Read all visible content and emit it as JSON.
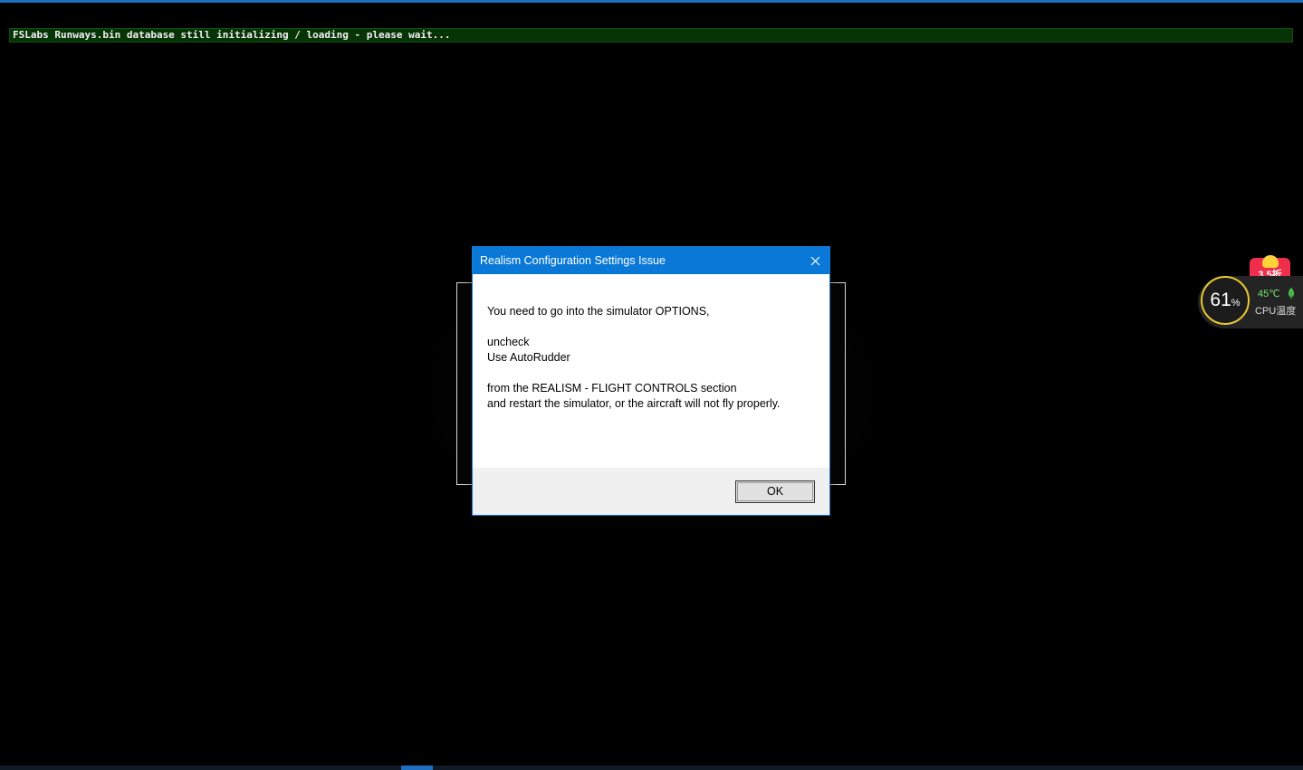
{
  "banner": {
    "text": "FSLabs Runways.bin database still initializing / loading - please wait..."
  },
  "dialog": {
    "title": "Realism Configuration Settings Issue",
    "lines": [
      "You need to go into the simulator OPTIONS,",
      "uncheck",
      "Use AutoRudder",
      "from the REALISM - FLIGHT CONTROLS section",
      "and restart the simulator, or the aircraft will not fly properly."
    ],
    "ok_label": "OK"
  },
  "cpu_widget": {
    "usage": "61",
    "usage_unit": "%",
    "temperature": "45℃",
    "label": "CPU温度",
    "promo": "3.5折"
  },
  "colors": {
    "accent": "#0a78d7",
    "banner_bg": "#063406",
    "gauge_ring": "#e8c832",
    "temp_text": "#6ee06e",
    "promo_bg": "#ee2e4a"
  },
  "icons": {
    "close": "close-icon",
    "leaf": "leaf-icon"
  }
}
